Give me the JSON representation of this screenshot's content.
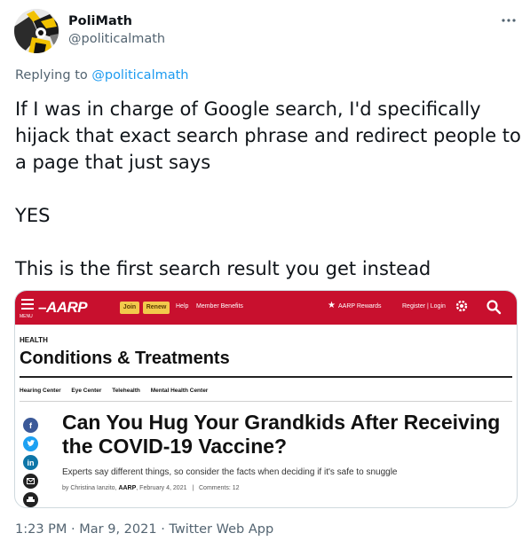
{
  "tweet": {
    "display_name": "PoliMath",
    "handle": "@politicalmath",
    "replying_prefix": "Replying to",
    "replying_handle": "@politicalmath",
    "body_paragraph_1": "If I was in charge of Google search, I'd specifically hijack that exact search phrase and redirect people to a page that just says",
    "body_paragraph_2": "YES",
    "body_paragraph_3": "This is the first search result you get instead",
    "time": "1:23 PM",
    "date": "Mar 9, 2021",
    "source": "Twitter Web App",
    "separator": "·",
    "more_icon": "more-dots-icon"
  },
  "media": {
    "aarp": {
      "brand_color": "#c8102e",
      "menu_label": "MENU",
      "logo": "AARP",
      "join_label": "Join",
      "renew_label": "Renew",
      "help_label": "Help",
      "member_benefits_label": "Member Benefits",
      "rewards_label": "AARP Rewards",
      "register_login": "Register | Login",
      "section_label": "HEALTH",
      "section_title": "Conditions & Treatments",
      "subnav": [
        "Hearing Center",
        "Eye Center",
        "Telehealth",
        "Mental Health Center"
      ],
      "headline": "Can You Hug Your Grandkids After Receiving the COVID-19 Vaccine?",
      "deck": "Experts say different things, so consider the facts when deciding if it's safe to snuggle",
      "byline_prefix": "by Christina Ianzito,",
      "byline_org": "AARP",
      "byline_date": ", February 4, 2021",
      "byline_sep": "|",
      "comments": "Comments: 12",
      "social_icons": [
        "facebook-icon",
        "twitter-icon",
        "linkedin-icon",
        "email-icon",
        "print-icon"
      ]
    }
  },
  "colors": {
    "link_blue": "#1d9bf0",
    "secondary_text": "#536471",
    "primary_text": "#0f1419"
  }
}
